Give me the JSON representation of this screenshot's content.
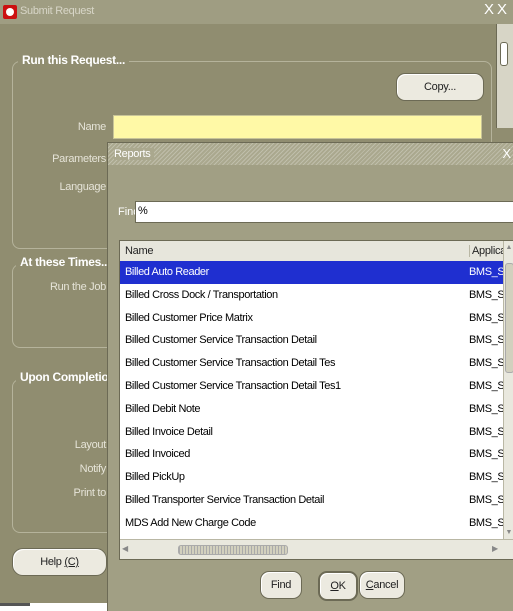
{
  "window": {
    "title": "Submit Request",
    "close_glyph": "X",
    "close_glyph2": "X",
    "icon": "oracle-logo-icon"
  },
  "run_request": {
    "group_label": "Run this Request...",
    "copy_label": "Copy...",
    "name_label": "Name",
    "name_value": "",
    "parameters_label": "Parameters",
    "language_label": "Language"
  },
  "at_times": {
    "group_label": "At these Times...",
    "run_job_label": "Run the Job"
  },
  "upon_completion": {
    "group_label": "Upon Completion...",
    "layout_label": "Layout",
    "notify_label": "Notify",
    "print_to_label": "Print to"
  },
  "help_button": {
    "label": "Help",
    "mnemonic": "(C)"
  },
  "lov": {
    "title": "Reports",
    "close_glyph": "X",
    "find_label": "Find",
    "find_value": "%",
    "columns": {
      "name": "Name",
      "application": "Application"
    },
    "rows": [
      {
        "name": "Billed Auto Reader",
        "app": "BMS_SYS",
        "selected": true
      },
      {
        "name": "Billed Cross Dock / Transportation",
        "app": "BMS_SYS"
      },
      {
        "name": "Billed Customer Price Matrix",
        "app": "BMS_SYS"
      },
      {
        "name": "Billed Customer Service Transaction Detail",
        "app": "BMS_SYS"
      },
      {
        "name": "Billed Customer Service Transaction Detail Tes",
        "app": "BMS_SYS"
      },
      {
        "name": "Billed Customer Service Transaction Detail Tes1",
        "app": "BMS_SYS"
      },
      {
        "name": "Billed Debit Note",
        "app": "BMS_SYS"
      },
      {
        "name": "Billed Invoice Detail",
        "app": "BMS_SYS"
      },
      {
        "name": "Billed Invoiced",
        "app": "BMS_SYS"
      },
      {
        "name": "Billed PickUp",
        "app": "BMS_SYS"
      },
      {
        "name": "Billed Transporter Service Transaction Detail",
        "app": "BMS_SYS"
      },
      {
        "name": "MDS Add New Charge Code",
        "app": "BMS_SYS"
      }
    ],
    "buttons": {
      "find": "Find",
      "ok_mnemonic": "O",
      "ok_rest": "K",
      "cancel_mnemonic": "C",
      "cancel_rest": "ancel"
    }
  },
  "colors": {
    "window_bg": "#908d70",
    "selection": "#1f2fd0",
    "name_field": "#fff9a6"
  }
}
